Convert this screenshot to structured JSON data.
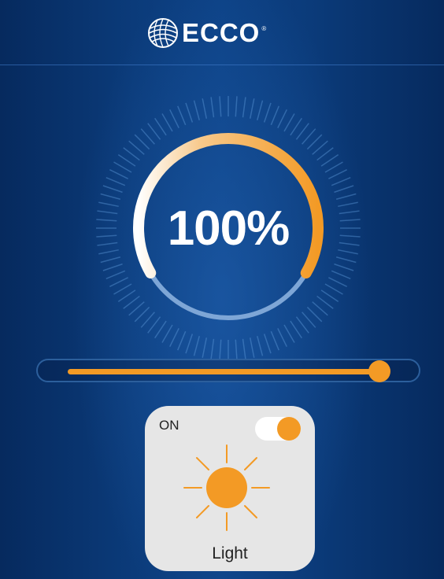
{
  "header": {
    "brand": "ECCO",
    "registered_mark": "®",
    "logo_icon": "globe-mesh-icon"
  },
  "dimmer": {
    "percent_label": "100%",
    "level": 1.0,
    "track_color": "#7ea6d6",
    "arc_color_start": "#ffffff",
    "arc_color_end": "#f39a25"
  },
  "slider": {
    "value": 1.0,
    "fill_color": "#f39a25"
  },
  "light_tile": {
    "state_label": "ON",
    "label": "Light",
    "icon": "sun-icon",
    "toggle_on": true,
    "accent_color": "#f39a25"
  }
}
